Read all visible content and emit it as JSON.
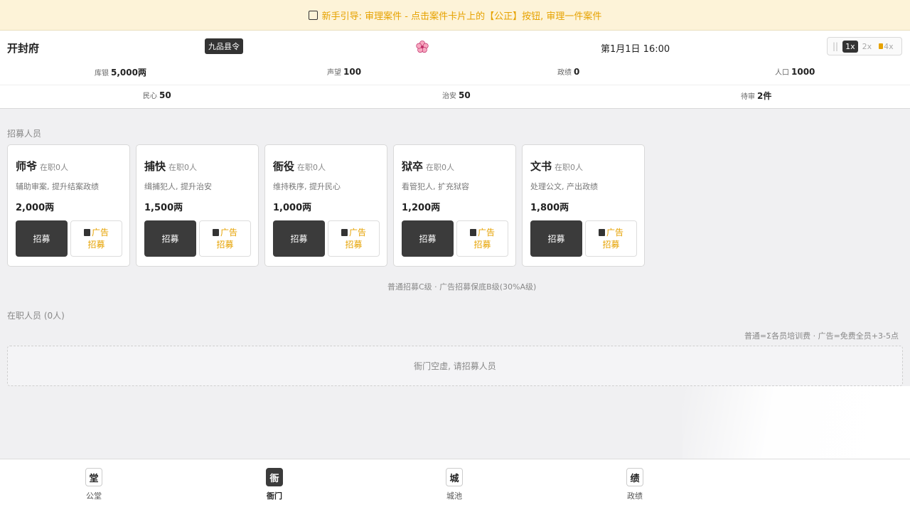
{
  "banner": {
    "icon": "checkbox-icon",
    "text": "新手引导: 审理案件 - 点击案件卡片上的【公正】按钮, 审理一件案件"
  },
  "header": {
    "city": "开封府",
    "rank_badge": "九品县令",
    "flower_icon": "flower-icon",
    "date": "第1月1日 16:00",
    "speed": {
      "pause": "||",
      "options": [
        "1x",
        "2x",
        "4x"
      ],
      "selected": "1x"
    }
  },
  "stats_row1": [
    {
      "label": "库银",
      "value": "5,000两"
    },
    {
      "label": "声望",
      "value": "100"
    },
    {
      "label": "政绩",
      "value": "0"
    },
    {
      "label": "人口",
      "value": "1000"
    }
  ],
  "stats_row2": [
    {
      "label": "民心",
      "value": "50"
    },
    {
      "label": "治安",
      "value": "50"
    },
    {
      "label": "待审",
      "value": "2件"
    }
  ],
  "recruit": {
    "title": "招募人员",
    "cards": [
      {
        "name": "师爷",
        "count": "在职0人",
        "desc": "辅助审案, 提升结案政绩",
        "price": "2,000两",
        "recruit_label": "招募",
        "ad_line1": "广告",
        "ad_line2": "招募"
      },
      {
        "name": "捕快",
        "count": "在职0人",
        "desc": "缉捕犯人, 提升治安",
        "price": "1,500两",
        "recruit_label": "招募",
        "ad_line1": "广告",
        "ad_line2": "招募"
      },
      {
        "name": "衙役",
        "count": "在职0人",
        "desc": "维持秩序, 提升民心",
        "price": "1,000两",
        "recruit_label": "招募",
        "ad_line1": "广告",
        "ad_line2": "招募"
      },
      {
        "name": "狱卒",
        "count": "在职0人",
        "desc": "看管犯人, 扩充狱容",
        "price": "1,200两",
        "recruit_label": "招募",
        "ad_line1": "广告",
        "ad_line2": "招募"
      },
      {
        "name": "文书",
        "count": "在职0人",
        "desc": "处理公文, 产出政绩",
        "price": "1,800两",
        "recruit_label": "招募",
        "ad_line1": "广告",
        "ad_line2": "招募"
      }
    ],
    "note": "普通招募C级 · 广告招募保底B级(30%A级)"
  },
  "staff": {
    "title": "在职人员 (0人)",
    "training_note": "普通=Σ各员培训费 · 广告=免费全员+3-5点",
    "empty_text": "衙门空虚, 请招募人员"
  },
  "nav": [
    {
      "icon_char": "堂",
      "label": "公堂",
      "active": false
    },
    {
      "icon_char": "衙",
      "label": "衙门",
      "active": true
    },
    {
      "icon_char": "城",
      "label": "城池",
      "active": false
    },
    {
      "icon_char": "绩",
      "label": "政绩",
      "active": false
    }
  ],
  "colors": {
    "accent": "#e6a200",
    "dark_button": "#3b3b3b",
    "banner_bg": "#fdf3d8"
  }
}
